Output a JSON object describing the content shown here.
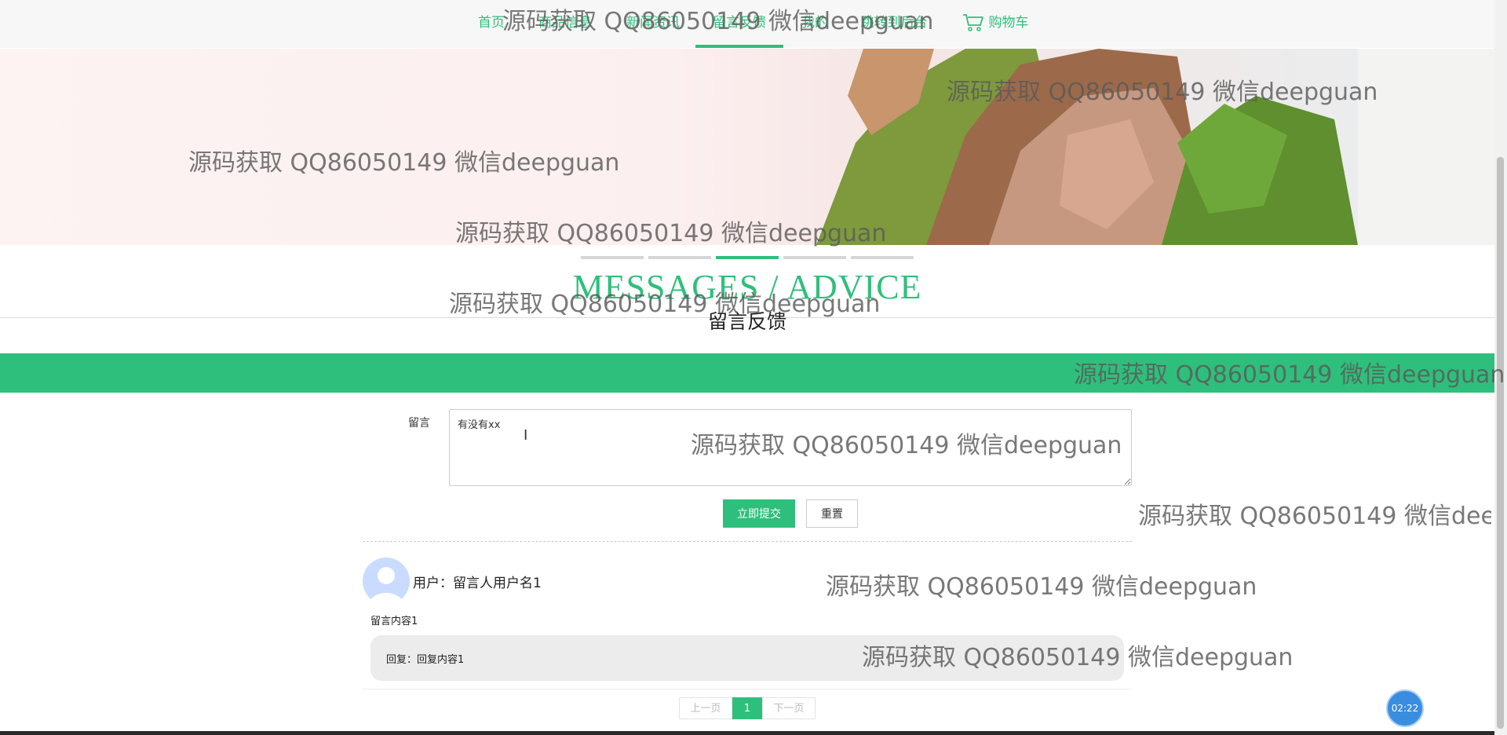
{
  "nav": {
    "items": [
      "首页",
      "商品信息",
      "新闻资讯",
      "留言反馈",
      "我的",
      "跳转到后台"
    ],
    "active_index": 3,
    "cart_label": "购物车"
  },
  "section": {
    "title_en": "MESSAGES / ADVICE",
    "title_cn": "留言反馈"
  },
  "form": {
    "label": "留言",
    "textarea_value": "有没有xx",
    "submit_label": "立即提交",
    "reset_label": "重置"
  },
  "messages": [
    {
      "user_label": "用户：留言人用户名1",
      "content": "留言内容1",
      "reply_label": "回复：",
      "reply": "回复内容1"
    }
  ],
  "pagination": {
    "prev": "上一页",
    "current": "1",
    "next": "下一页"
  },
  "timer": "02:22",
  "watermark": "源码获取 QQ86050149 微信deepguan",
  "colors": {
    "accent": "#2fbf7c",
    "timer": "#3b8de0"
  }
}
